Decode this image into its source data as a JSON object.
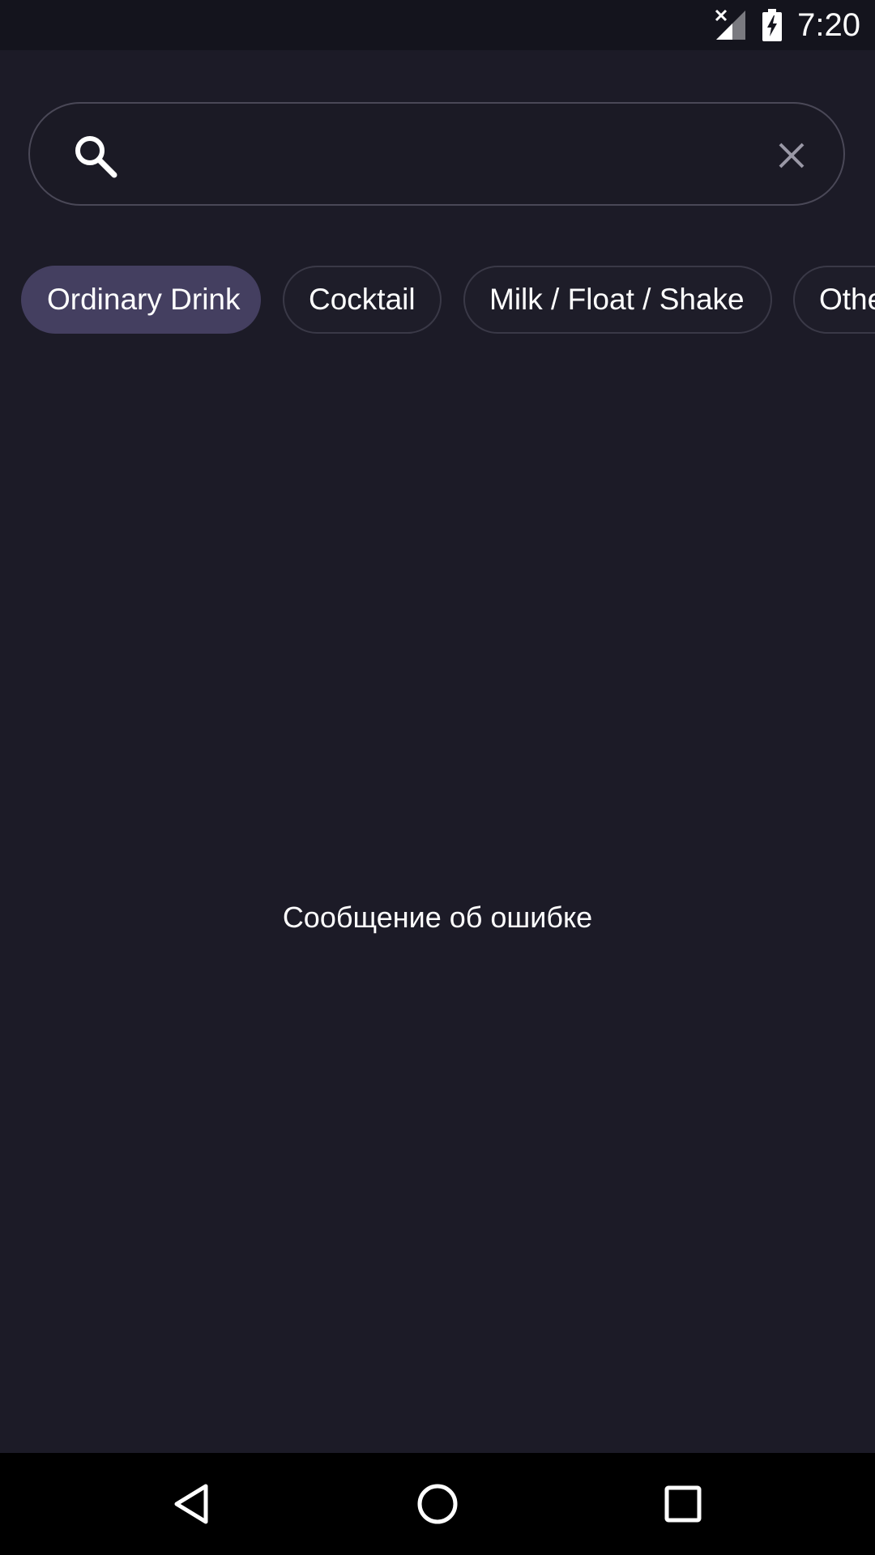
{
  "status_bar": {
    "time": "7:20",
    "icons": [
      "signal-no-data-icon",
      "battery-charging-icon"
    ]
  },
  "search": {
    "value": "",
    "placeholder": "",
    "icon": "search-icon",
    "clear_icon": "close-icon"
  },
  "categories": {
    "selected": "Ordinary Drink",
    "items": [
      {
        "label": "Ordinary Drink"
      },
      {
        "label": "Cocktail"
      },
      {
        "label": "Milk / Float / Shake"
      },
      {
        "label": "Othe"
      }
    ]
  },
  "content": {
    "error_message": "Сообщение об ошибке"
  },
  "nav_bar": {
    "icons": [
      "back-icon",
      "home-icon",
      "recents-icon"
    ]
  },
  "colors": {
    "background": "#1c1b27",
    "chip_selected": "#443f60",
    "chip_border": "#3a3947",
    "search_border": "#4a4857"
  }
}
